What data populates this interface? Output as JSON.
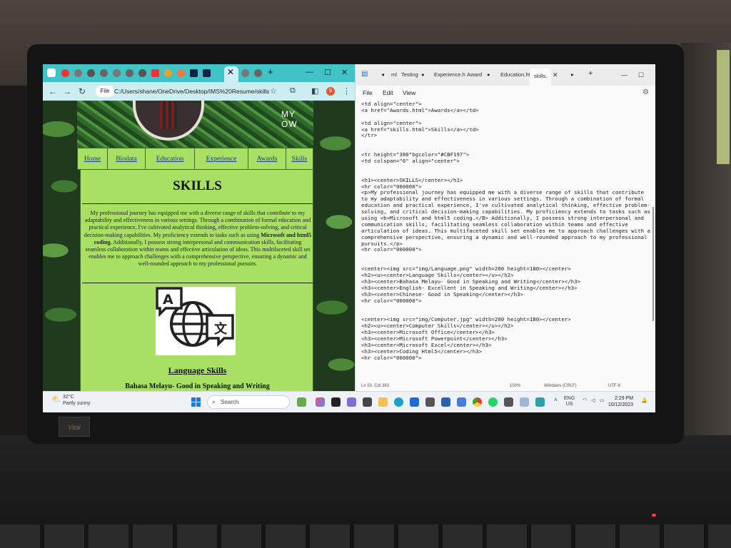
{
  "browser": {
    "tabs_count_visible": 12,
    "address": {
      "file_label": "File",
      "url": "C:/Users/shane/OneDrive/Desktop/IMS%20Resume/skills...."
    },
    "profile_initial": "S",
    "page": {
      "banner_text": "MY OW",
      "nav": [
        "Home",
        "Biodata",
        "Education",
        "Experience",
        "Awards",
        "Skills"
      ],
      "title": "SKILLS",
      "paragraph_before_bold": "My professional journey has equipped me with a diverse range of skills that contribute to my adaptability and effectiveness in various settings. Through a combination of formal education and practical experience, I've cultivated analytical thinking, effective problem-solving, and critical decision-making capabilities. My proficiency extends to tasks such as using ",
      "paragraph_bold": "Microsoft and html5 coding.",
      "paragraph_after_bold": " Additionally, I possess strong interpersonal and communication skills, facilitating seamless collaboration within teams and effective articulation of ideas. This multifaceted skill set enables me to approach challenges with a comprehensive perspective, ensuring a dynamic and well-rounded approach to my professional pursuits.",
      "language_heading": "Language Skills",
      "language_line_1": "Bahasa Melayu- Good in Speaking and Writing"
    }
  },
  "editor": {
    "tabs": [
      "ml",
      "Testing",
      "Experience.h",
      "Award",
      "Education.ht",
      "skills."
    ],
    "menu": [
      "File",
      "Edit",
      "View"
    ],
    "code_lines": [
      "<td align=\"center\">",
      "<a href=\"Awards.html\">Awards</a></td>",
      "",
      "<td align=\"center\">",
      "<a href=\"skills.html\">Skills</a></td>",
      "</tr>",
      "",
      "",
      "<tr height=\"380\"bgcolor=\"#CBF197\">",
      "<td colspan=\"6\" align=\"center\">",
      "",
      "",
      "<h1><center>SKILLS</center></h1>",
      "<hr color=\"000000\">",
      "<p>My professional journey has equipped me with a diverse range of skills that contribute",
      "to my adaptability and effectiveness in various settings. Through a combination of formal",
      "education and practical experience, I've cultivated analytical thinking, effective problem-",
      "solving, and critical decision-making capabilities. My proficiency extends to tasks such as",
      "using <b>Microsoft and html5 coding.</B> Additionally, I possess strong interpersonal and",
      "communication skills, facilitating seamless collaboration within teams and effective",
      "articulation of ideas. This multifaceted skill set enables me to approach challenges with a",
      "comprehensive perspective, ensuring a dynamic and well-rounded approach to my professional",
      "pursuits.</p>",
      "<hr color=\"000000\">",
      "",
      "",
      "<center><img src=\"img/Language.png\" width=200 height=180></center>",
      "<h2><u><center>Language Skills</center></u></h2>",
      "<h3><center>Bahasa Melayu- Good in Speaking and Writing</center></h3>",
      "<h3><center>English- Excellent in Speaking and Writing</center></h3>",
      "<h3><center>Chinese- Good in Speaking</center></h3>",
      "<hr color=\"000000\">",
      "",
      "",
      "<center><img src=\"img/Computer.jpg\" width=200 height=180></center>",
      "<h2><u><center>Computer Skills</center></u></h2>",
      "<h3><center>Microsoft Office</center></h3>",
      "<h3><center>Microsoft Powerpoint</center></h3>",
      "<h3><center>Microsoft Excel</center></h3>",
      "<h3><center>Coding Html5</center></h3>",
      "<hr color=\"000000\">"
    ],
    "status": {
      "position": "Ln 50, Col 383",
      "zoom": "100%",
      "line_ending": "Windows (CRLF)",
      "encoding": "UTF-8"
    }
  },
  "taskbar": {
    "weather_temp": "32°C",
    "weather_desc": "Partly sunny",
    "search_placeholder": "Search",
    "lang_line1": "ENG",
    "lang_line2": "US",
    "time": "2:29 PM",
    "date": "10/12/2023"
  },
  "laptop_brand": "Vital"
}
